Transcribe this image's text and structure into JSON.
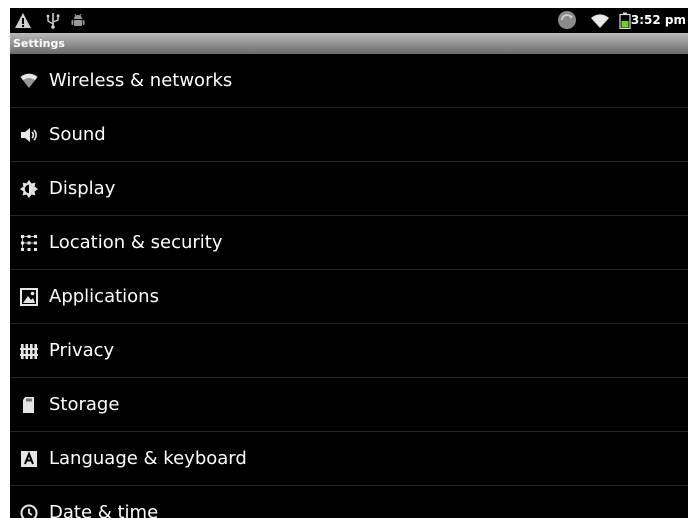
{
  "status_bar": {
    "time": "3:52 pm",
    "icons": [
      "warning-icon",
      "usb-icon",
      "android-debug-icon",
      "sync-icon",
      "wifi-icon",
      "battery-icon"
    ]
  },
  "title_bar": {
    "title": "Settings"
  },
  "settings": {
    "items": [
      {
        "label": "Wireless & networks",
        "icon": "wifi-icon"
      },
      {
        "label": "Sound",
        "icon": "speaker-icon"
      },
      {
        "label": "Display",
        "icon": "brightness-icon"
      },
      {
        "label": "Location & security",
        "icon": "location-grid-icon"
      },
      {
        "label": "Applications",
        "icon": "applications-icon"
      },
      {
        "label": "Privacy",
        "icon": "privacy-icon"
      },
      {
        "label": "Storage",
        "icon": "sd-card-icon"
      },
      {
        "label": "Language & keyboard",
        "icon": "language-icon"
      },
      {
        "label": "Date & time",
        "icon": "clock-icon"
      }
    ]
  },
  "colors": {
    "background": "#000000",
    "title_bar": "#8e8e8e",
    "battery": "#6fcf1f",
    "text": "#ffffff"
  }
}
